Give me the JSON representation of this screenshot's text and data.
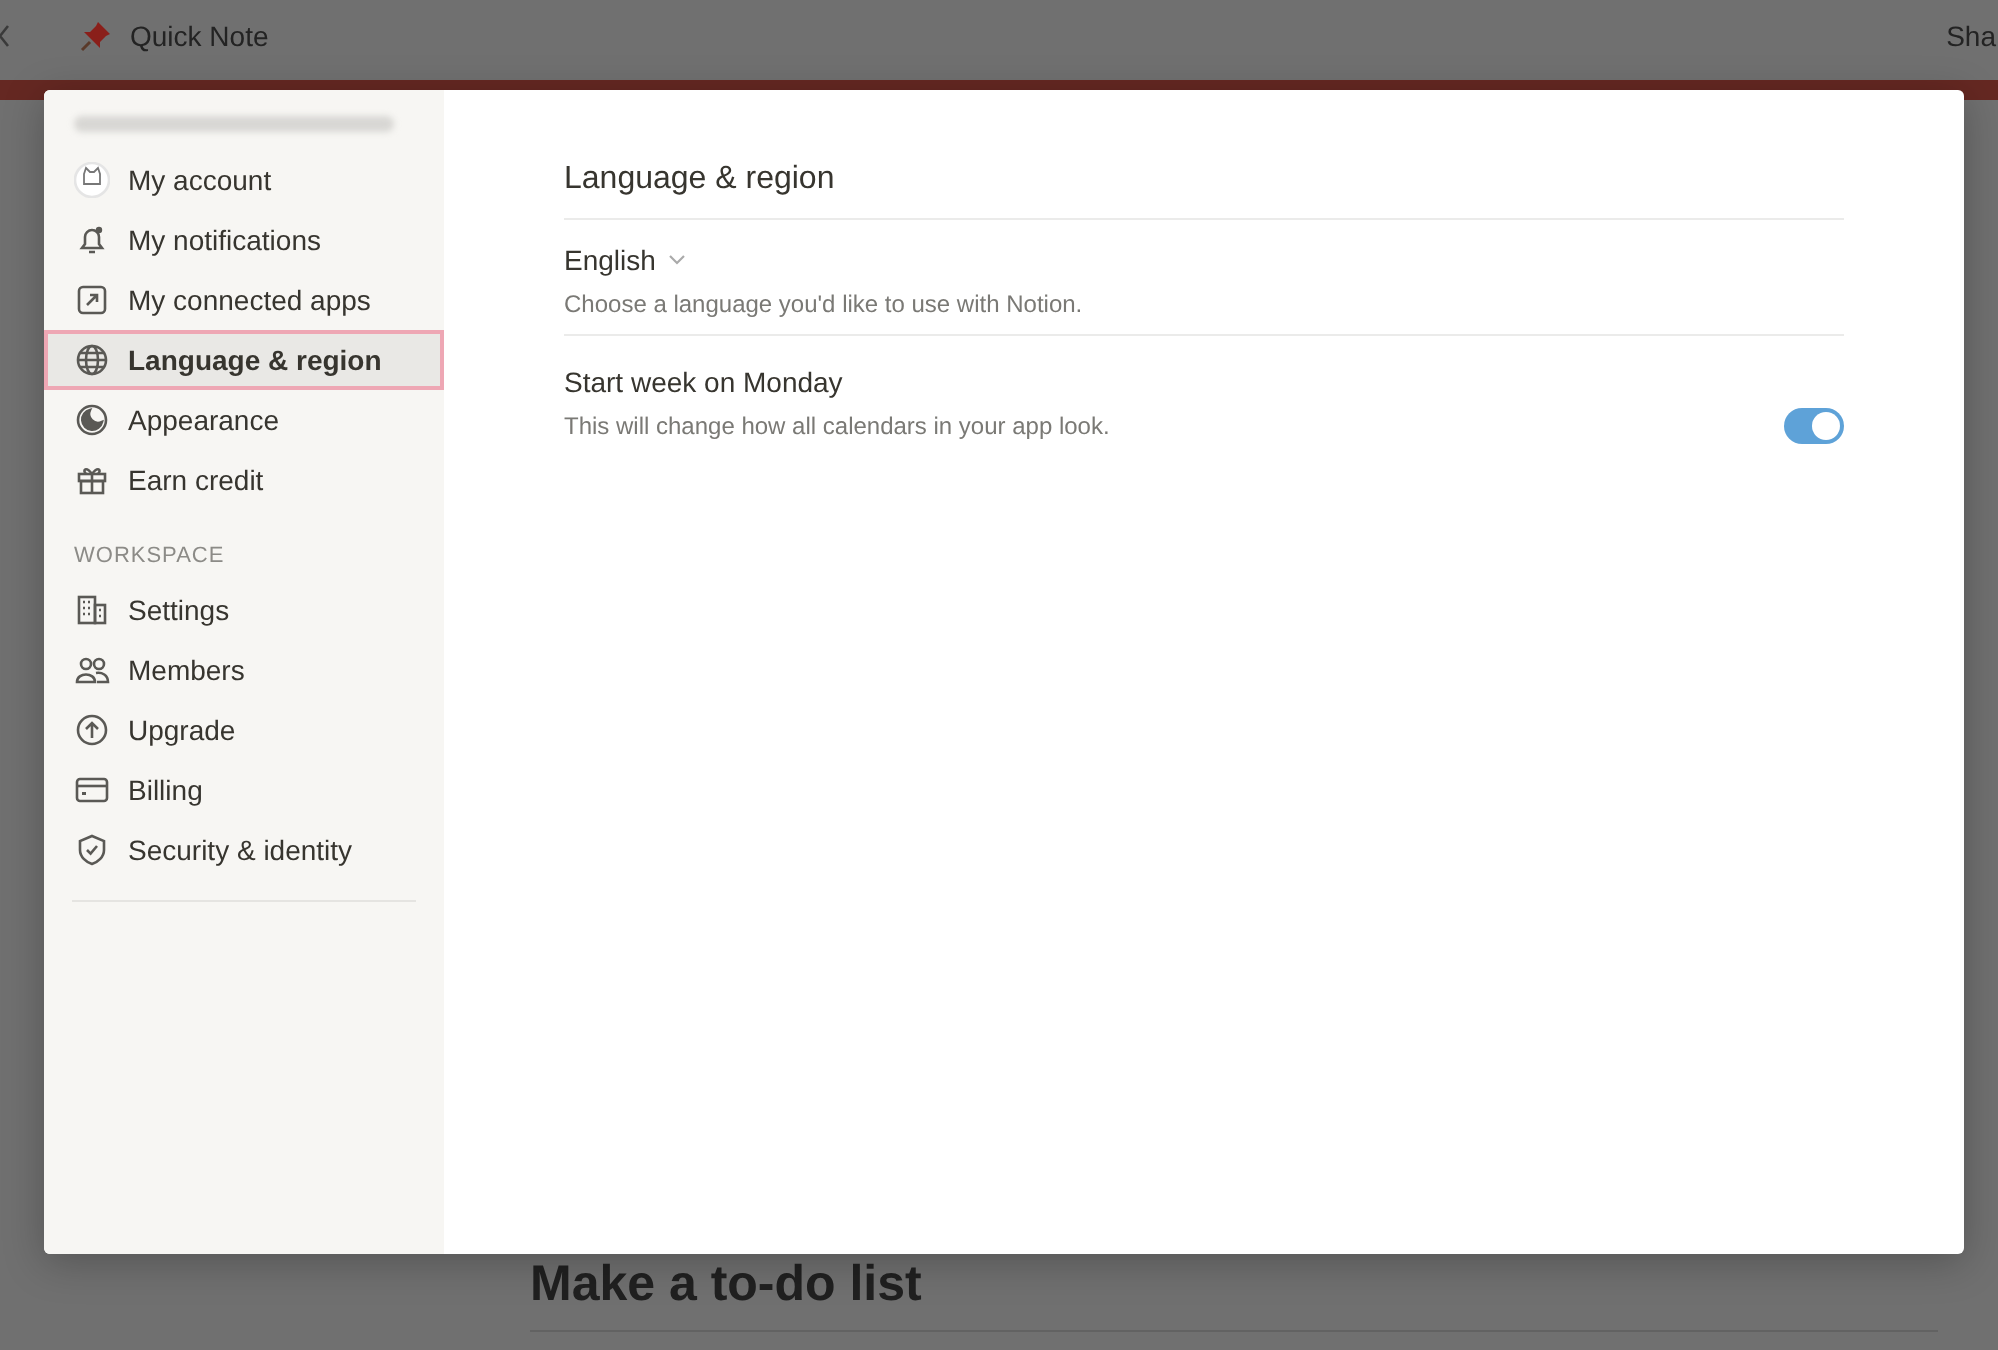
{
  "page": {
    "title": "Quick Note",
    "share_label": "Sha",
    "heading": "Make a to-do list"
  },
  "sidebar": {
    "account_groups": [
      {
        "items": [
          {
            "label": "My account",
            "selected": false
          },
          {
            "label": "My notifications",
            "selected": false
          },
          {
            "label": "My connected apps",
            "selected": false
          },
          {
            "label": "Language & region",
            "selected": true
          },
          {
            "label": "Appearance",
            "selected": false
          },
          {
            "label": "Earn credit",
            "selected": false
          }
        ]
      },
      {
        "heading": "WORKSPACE",
        "items": [
          {
            "label": "Settings",
            "selected": false
          },
          {
            "label": "Members",
            "selected": false
          },
          {
            "label": "Upgrade",
            "selected": false
          },
          {
            "label": "Billing",
            "selected": false
          },
          {
            "label": "Security & identity",
            "selected": false
          }
        ]
      }
    ]
  },
  "content": {
    "title": "Language & region",
    "language": {
      "value": "English",
      "description": "Choose a language you'd like to use with Notion."
    },
    "start_week": {
      "label": "Start week on Monday",
      "description": "This will change how all calendars in your app look.",
      "on": true
    }
  }
}
